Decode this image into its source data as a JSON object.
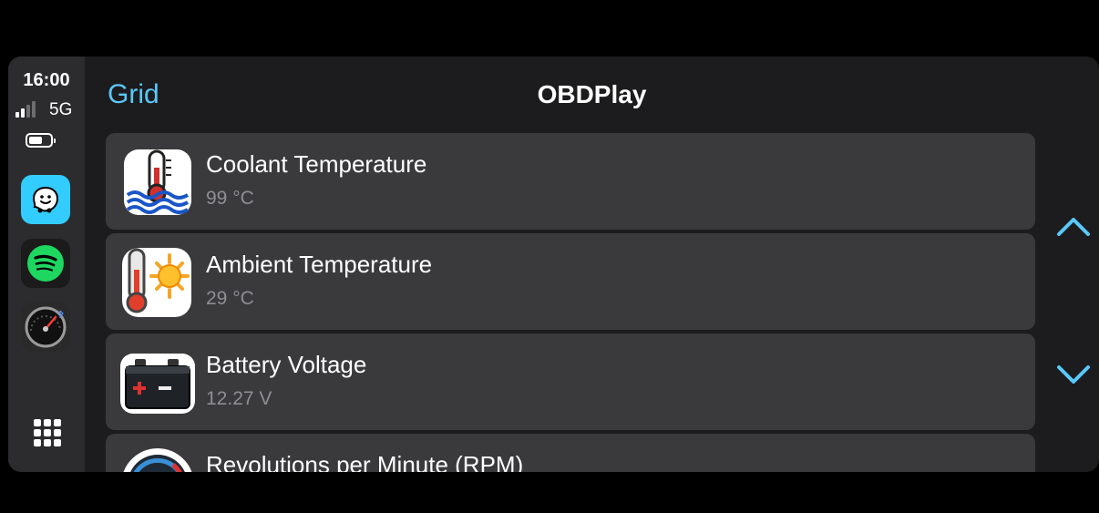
{
  "status": {
    "time": "16:00",
    "network": "5G"
  },
  "dock": {
    "apps": [
      {
        "icon": "waze-icon"
      },
      {
        "icon": "spotify-icon"
      },
      {
        "icon": "obd-gauge-icon"
      }
    ],
    "home_icon": "grid-icon"
  },
  "header": {
    "back_label": "Grid",
    "title": "OBDPlay"
  },
  "items": [
    {
      "title": "Coolant Temperature",
      "value": "99 °C",
      "icon": "coolant-thermometer-icon"
    },
    {
      "title": "Ambient Temperature",
      "value": "29 °C",
      "icon": "sun-thermometer-icon"
    },
    {
      "title": "Battery Voltage",
      "value": "12.27 V",
      "icon": "car-battery-icon"
    },
    {
      "title": "Revolutions per Minute (RPM)",
      "value": "",
      "icon": "tachometer-icon"
    }
  ],
  "scroll": {
    "up_icon": "chevron-up-icon",
    "down_icon": "chevron-down-icon"
  },
  "colors": {
    "accent": "#5ac8fa",
    "row_bg": "#3a3a3c",
    "screen_bg": "#1c1c1e",
    "sidebar_bg": "#2c2c2e"
  }
}
